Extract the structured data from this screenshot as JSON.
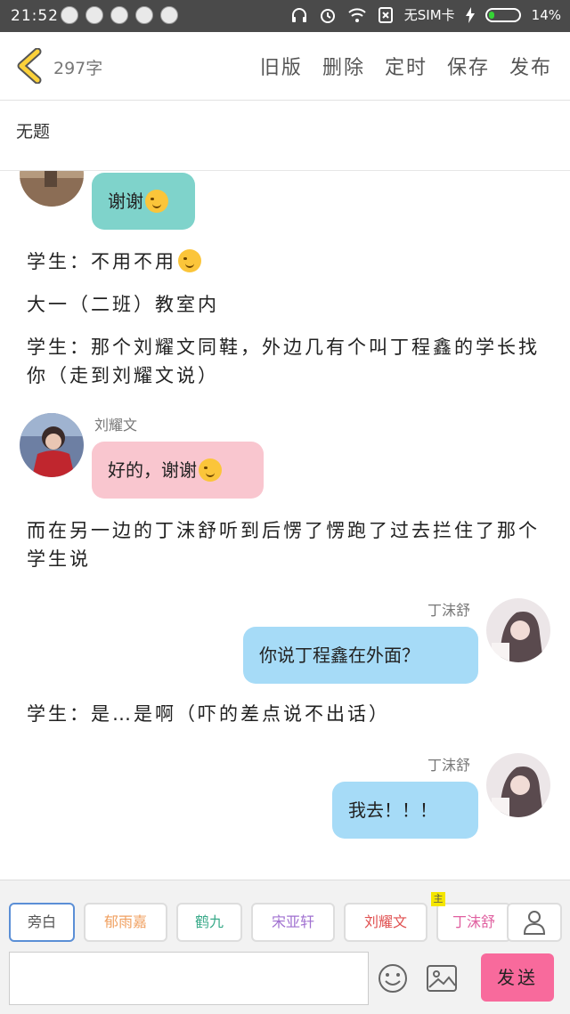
{
  "status_bar": {
    "time": "21:52",
    "sim": "无SIM卡",
    "battery": "14%",
    "battery_level": 0.14
  },
  "toolbar": {
    "word_count": "297字",
    "actions": [
      "旧版",
      "删除",
      "定时",
      "保存",
      "发布"
    ]
  },
  "story": {
    "title": "无题",
    "messages": [
      {
        "type": "bubble",
        "side": "left",
        "color": "teal",
        "speaker": "",
        "text": "谢谢",
        "emoji": true
      },
      {
        "type": "narration",
        "text": "学生：不用不用",
        "emoji": true
      },
      {
        "type": "narration",
        "text": "大一（二班）教室内"
      },
      {
        "type": "narration",
        "text": "学生：那个刘耀文同鞋，外边几有个叫丁程鑫的学长找你（走到刘耀文说）"
      },
      {
        "type": "bubble",
        "side": "left",
        "color": "pink",
        "speaker": "刘耀文",
        "text": "好的，谢谢",
        "emoji": true
      },
      {
        "type": "narration",
        "text": "而在另一边的丁沫舒听到后愣了愣跑了过去拦住了那个学生说"
      },
      {
        "type": "bubble",
        "side": "right",
        "color": "blue",
        "speaker": "丁沫舒",
        "text": "你说丁程鑫在外面？"
      },
      {
        "type": "narration",
        "text": "学生：是…是啊（吓的差点说不出话）"
      },
      {
        "type": "bubble",
        "side": "right",
        "color": "blue",
        "speaker": "丁沫舒",
        "text": "我去！！！"
      }
    ]
  },
  "composer": {
    "roles": [
      {
        "label": "旁白",
        "color": "#555555",
        "selected": true
      },
      {
        "label": "郁雨嘉",
        "color": "#f0a060"
      },
      {
        "label": "鹤九",
        "color": "#3aaa8a"
      },
      {
        "label": "宋亚轩",
        "color": "#a070d0"
      },
      {
        "label": "刘耀文",
        "color": "#e05050"
      },
      {
        "label": "丁沫舒",
        "color": "#e060a0",
        "badge": "主"
      }
    ],
    "send_label": "发送",
    "input_value": ""
  },
  "colors": {
    "teal_bubble": "#7fd3cb",
    "pink_bubble": "#f9c6cf",
    "blue_bubble": "#a6dbf7",
    "send_button": "#f86a9c"
  }
}
